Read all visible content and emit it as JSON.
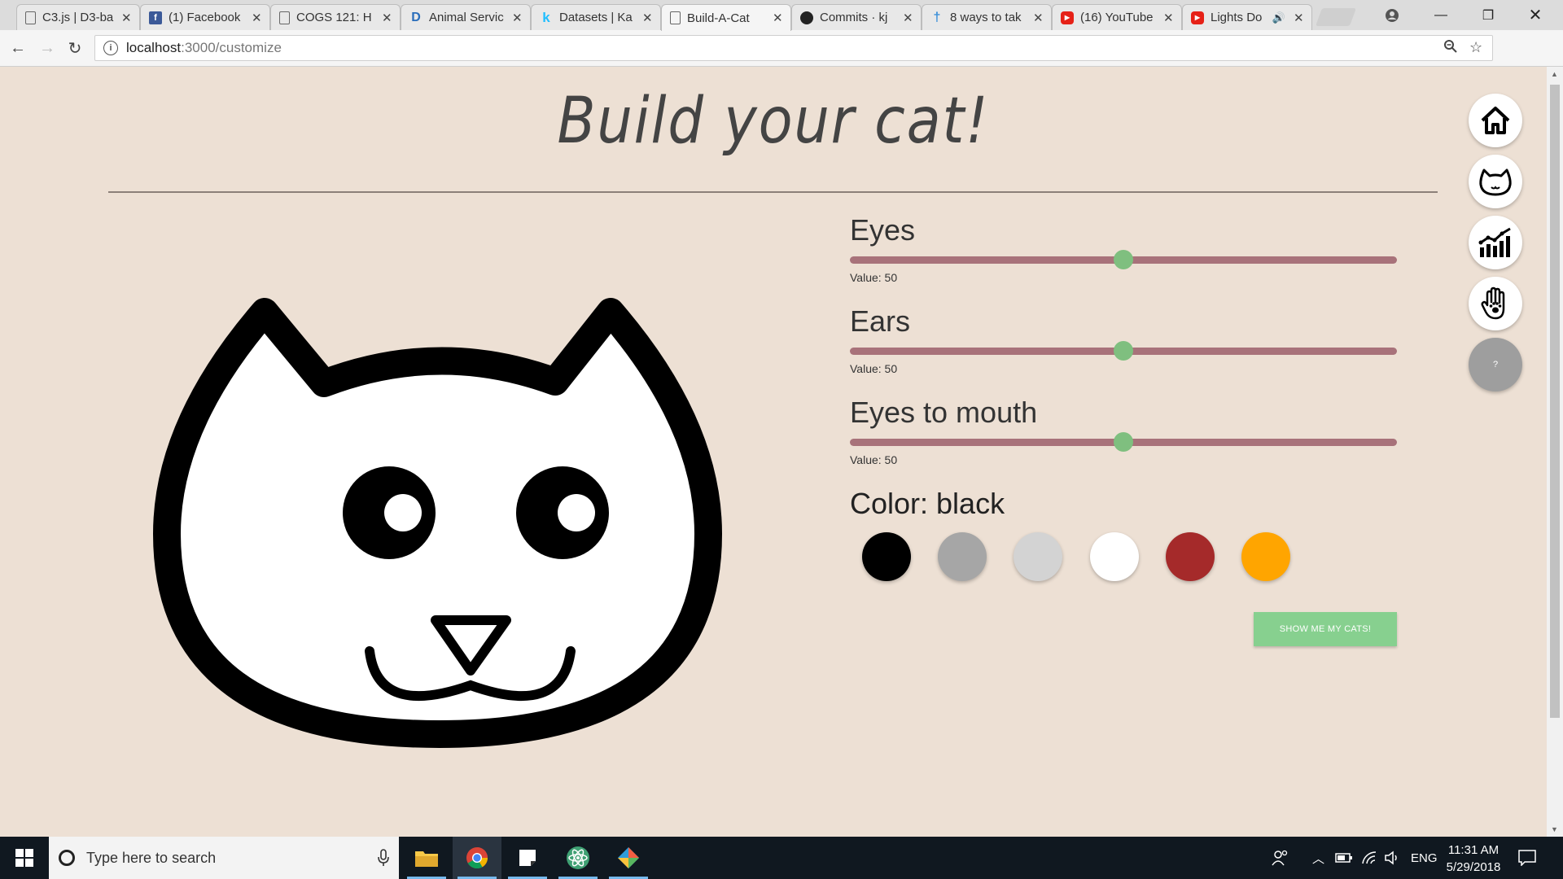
{
  "browser": {
    "tabs": [
      {
        "label": "C3.js | D3-ba",
        "icon": "document-icon",
        "active": false
      },
      {
        "label": "(1) Facebook",
        "icon": "facebook-icon",
        "active": false
      },
      {
        "label": "COGS 121: H",
        "icon": "document-icon",
        "active": false
      },
      {
        "label": "Animal Servic",
        "icon": "d-icon",
        "active": false
      },
      {
        "label": "Datasets | Ka",
        "icon": "kaggle-icon",
        "active": false
      },
      {
        "label": "Build-A-Cat",
        "icon": "document-icon",
        "active": true
      },
      {
        "label": "Commits · kj",
        "icon": "github-icon",
        "active": false
      },
      {
        "label": "8 ways to tak",
        "icon": "pin-icon",
        "active": false
      },
      {
        "label": "(16) YouTube",
        "icon": "youtube-icon",
        "active": false
      },
      {
        "label": "Lights Do",
        "icon": "youtube-icon",
        "active": false
      }
    ],
    "url_host": "localhost",
    "url_path": ":3000/customize"
  },
  "page": {
    "title": "Build your cat!",
    "controls": [
      {
        "label": "Eyes",
        "value_text": "Value: 50",
        "value": 50,
        "max": 100
      },
      {
        "label": "Ears",
        "value_text": "Value: 50",
        "value": 50,
        "max": 100
      },
      {
        "label": "Eyes to mouth",
        "value_text": "Value: 50",
        "value": 50,
        "max": 100
      }
    ],
    "color_title": "Color: black",
    "swatches": [
      {
        "name": "black",
        "hex": "#000000"
      },
      {
        "name": "gray",
        "hex": "#a6a6a6"
      },
      {
        "name": "lightgray",
        "hex": "#d3d3d3"
      },
      {
        "name": "white",
        "hex": "#ffffff"
      },
      {
        "name": "brown",
        "hex": "#a52a2a"
      },
      {
        "name": "orange",
        "hex": "#ffa500"
      }
    ],
    "show_button": "SHOW ME MY CATS!",
    "side_nav": [
      {
        "name": "home-icon"
      },
      {
        "name": "cat-face-icon"
      },
      {
        "name": "chart-icon"
      },
      {
        "name": "paw-hand-icon"
      },
      {
        "name": "help",
        "label": "?"
      }
    ],
    "colors": {
      "background": "#ede0d4",
      "slider_track": "#a8727a",
      "slider_thumb": "#7fbf7f",
      "button": "#87d08f"
    }
  },
  "taskbar": {
    "search_placeholder": "Type here to search",
    "language": "ENG",
    "time": "11:31 AM",
    "date": "5/29/2018"
  }
}
